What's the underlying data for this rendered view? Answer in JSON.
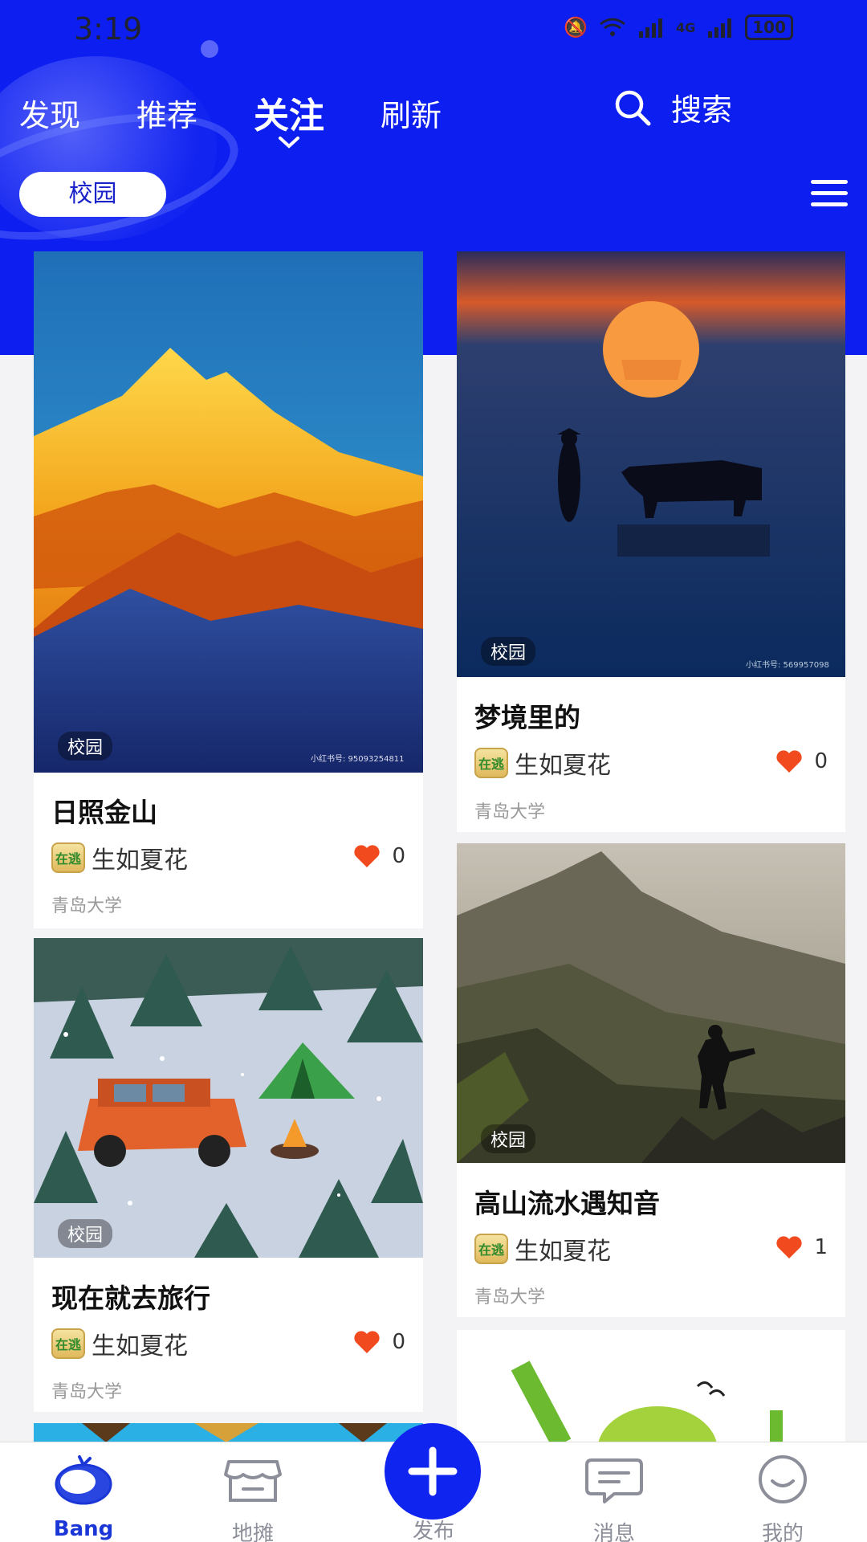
{
  "status_bar": {
    "time": "3:19",
    "network": "4G",
    "battery": "100"
  },
  "header": {
    "tabs": [
      {
        "label": "发现"
      },
      {
        "label": "推荐"
      },
      {
        "label": "关注",
        "active": true
      },
      {
        "label": "刷新"
      }
    ],
    "search_label": "搜索",
    "chip_label": "校园",
    "accent_color": "#0d1ef0"
  },
  "posts": [
    {
      "tag": "校园",
      "title": "日照金山",
      "author": "生如夏花",
      "avatar_text": "在逃",
      "likes": "0",
      "school": "青岛大学"
    },
    {
      "tag": "校园",
      "title": "梦境里的",
      "author": "生如夏花",
      "avatar_text": "在逃",
      "likes": "0",
      "school": "青岛大学"
    },
    {
      "tag": "校园",
      "title": "现在就去旅行",
      "author": "生如夏花",
      "avatar_text": "在逃",
      "likes": "0",
      "school": "青岛大学"
    },
    {
      "tag": "校园",
      "title": "高山流水遇知音",
      "author": "生如夏花",
      "avatar_text": "在逃",
      "likes": "1",
      "school": "青岛大学"
    }
  ],
  "watermarks": {
    "left": "小红书号: 95093254811",
    "right": "小红书号: 569957098"
  },
  "bottom_nav": {
    "items": [
      {
        "label": "Bang",
        "icon": "tomato-icon",
        "active": true
      },
      {
        "label": "地摊",
        "icon": "stall-icon"
      },
      {
        "label": "发布",
        "icon": "plus-icon"
      },
      {
        "label": "消息",
        "icon": "message-icon"
      },
      {
        "label": "我的",
        "icon": "smile-icon"
      }
    ]
  }
}
